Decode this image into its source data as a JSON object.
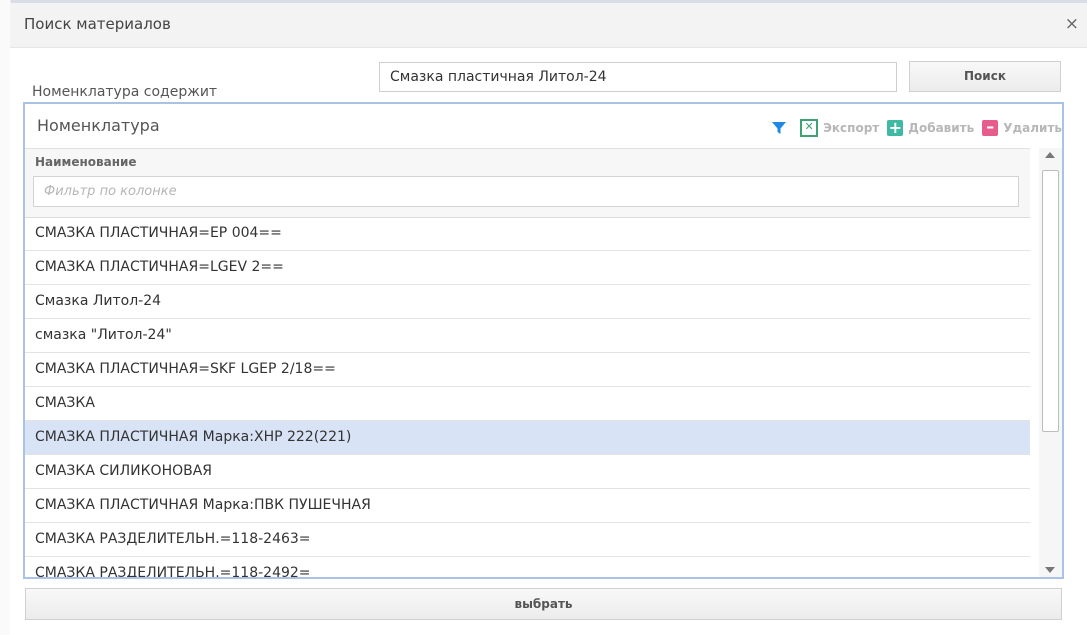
{
  "dialog": {
    "title": "Поиск материалов",
    "close_symbol": "×",
    "close_icon": "close-icon"
  },
  "search": {
    "label": "Номенклатура содержит",
    "value": "Смазка пластичная Литол-24",
    "button_label": "Поиск"
  },
  "panel": {
    "title": "Номенклатура",
    "toolbar": {
      "filter_icon": "filter-funnel-icon",
      "filter_color": "#1e88e5",
      "export_label": "Экспорт",
      "export_icon": "excel-icon",
      "export_color": "#3aa476",
      "add_label": "Добавить",
      "add_icon": "plus-icon",
      "add_color": "#3fb9a2",
      "delete_label": "Удалить",
      "delete_icon": "minus-icon",
      "delete_color": "#e65c8c"
    },
    "grid": {
      "column_header": "Наименование",
      "filter_placeholder": "Фильтр по колонке",
      "selected_row_color": "#d8e3f6",
      "rows": [
        "СМАЗКА ПЛАСТИЧНАЯ=EP 004==",
        "СМАЗКА ПЛАСТИЧНАЯ=LGEV 2==",
        "Смазка Литол-24",
        "смазка \"Литол-24\"",
        "СМАЗКА ПЛАСТИЧНАЯ=SKF LGEP 2/18==",
        "СМАЗКА",
        "СМАЗКА ПЛАСТИЧНАЯ Марка:ХНР 222(221)",
        "СМАЗКА СИЛИКОНОВАЯ",
        "СМАЗКА ПЛАСТИЧНАЯ Марка:ПВК ПУШЕЧНАЯ",
        "СМАЗКА РАЗДЕЛИТЕЛЬН.=118-2463=",
        "СМАЗКА РАЗДЕЛИТЕЛЬН.=118-2492="
      ],
      "selected_index": 6
    }
  },
  "footer": {
    "select_label": "выбрать"
  }
}
